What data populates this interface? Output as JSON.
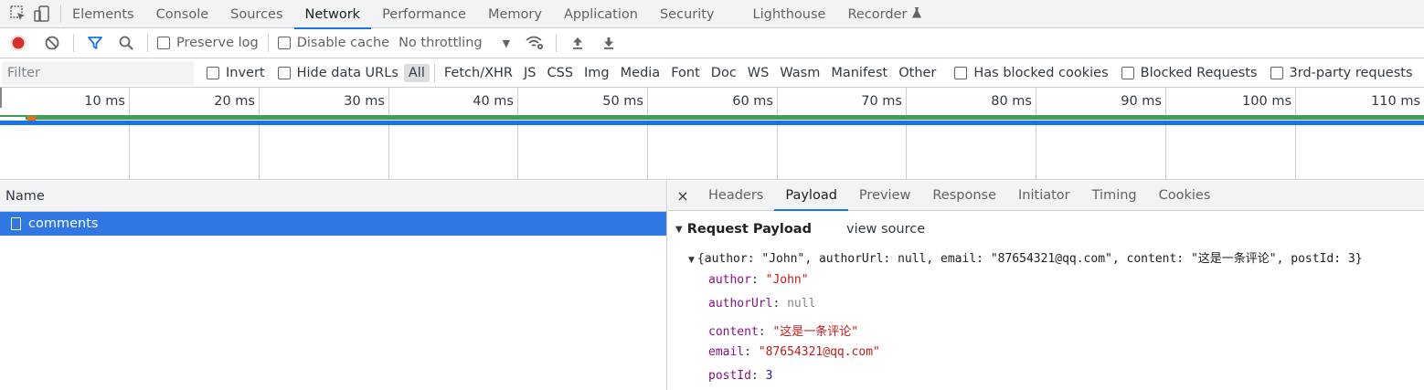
{
  "topbar": {
    "tabs": [
      "Elements",
      "Console",
      "Sources",
      "Network",
      "Performance",
      "Memory",
      "Application",
      "Security",
      "Lighthouse",
      "Recorder"
    ],
    "active_tab": "Network"
  },
  "toolbar": {
    "preserve_log": "Preserve log",
    "disable_cache": "Disable cache",
    "throttling": "No throttling"
  },
  "filterbar": {
    "placeholder": "Filter",
    "invert": "Invert",
    "hide_data_urls": "Hide data URLs",
    "types": [
      "All",
      "Fetch/XHR",
      "JS",
      "CSS",
      "Img",
      "Media",
      "Font",
      "Doc",
      "WS",
      "Wasm",
      "Manifest",
      "Other"
    ],
    "has_blocked_cookies": "Has blocked cookies",
    "blocked_requests": "Blocked Requests",
    "third_party": "3rd-party requests"
  },
  "timeline": {
    "ticks": [
      "10 ms",
      "20 ms",
      "30 ms",
      "40 ms",
      "50 ms",
      "60 ms",
      "70 ms",
      "80 ms",
      "90 ms",
      "100 ms",
      "110 ms"
    ]
  },
  "requests": {
    "column_name": "Name",
    "rows": [
      {
        "name": "comments"
      }
    ]
  },
  "details": {
    "tabs": [
      "Headers",
      "Payload",
      "Preview",
      "Response",
      "Initiator",
      "Timing",
      "Cookies"
    ],
    "active_tab": "Payload",
    "close": "×",
    "section_title": "Request Payload",
    "view_source": "view source",
    "summary": "{author: \"John\", authorUrl: null, email: \"87654321@qq.com\", content: \"这是一条评论\", postId: 3}",
    "props": {
      "author_key": "author",
      "author_val": "\"John\"",
      "authorUrl_key": "authorUrl",
      "authorUrl_val": "null",
      "content_key": "content",
      "content_val": "\"这是一条评论\"",
      "email_key": "email",
      "email_val": "\"87654321@qq.com\"",
      "postId_key": "postId",
      "postId_val": "3"
    }
  },
  "colors": {
    "accent": "#1a73e8",
    "record": "#d93025",
    "selected_row": "#2f78e4",
    "bar_green": "#3ea056"
  }
}
